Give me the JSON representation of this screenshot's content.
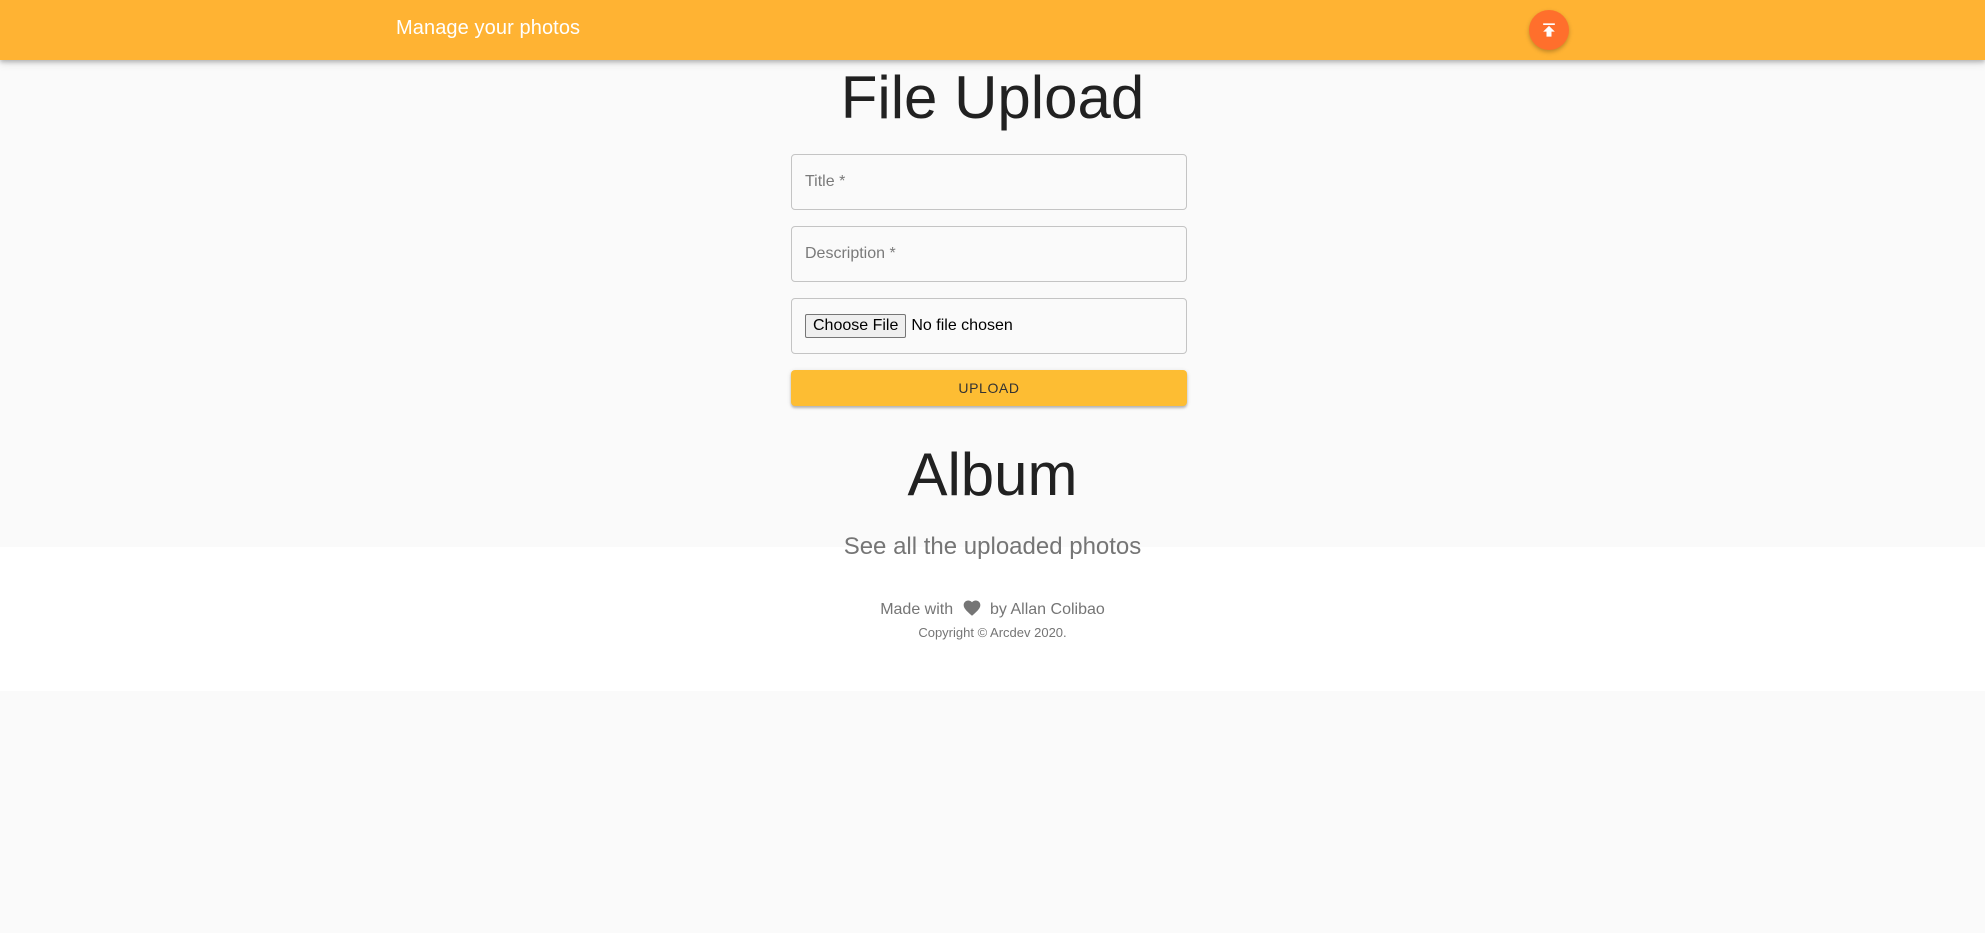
{
  "header": {
    "title": "Manage your photos",
    "upload_icon": "publish-icon"
  },
  "upload": {
    "heading": "File Upload",
    "title_placeholder": "Title *",
    "description_placeholder": "Description *",
    "choose_file_label": "Choose File",
    "no_file_text": "No file chosen",
    "upload_label": "UPLOAD"
  },
  "album": {
    "heading": "Album",
    "subtitle": "See all the uploaded photos"
  },
  "footer": {
    "made_with": "Made with",
    "heart_icon": "heart-icon",
    "by": "by Allan Colibao",
    "copyright": "Copyright © Arcdev 2020."
  },
  "colors": {
    "app_bar": "#ffb333",
    "fab": "#ff6f2c",
    "upload_button": "#fdbd33",
    "background": "#fafafa"
  }
}
